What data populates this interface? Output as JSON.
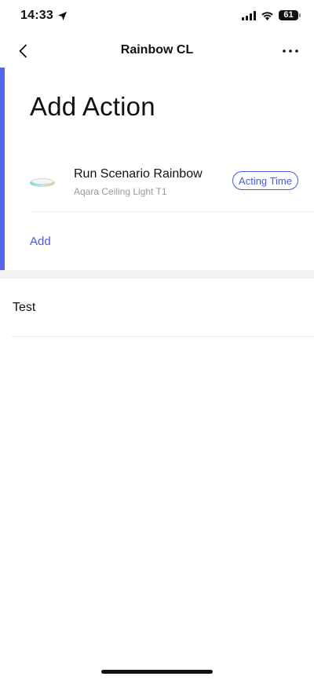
{
  "status_bar": {
    "time": "14:33",
    "battery": "61",
    "icons": [
      "location-arrow-icon",
      "cellular-signal-icon",
      "wifi-icon",
      "battery-icon"
    ]
  },
  "nav": {
    "title": "Rainbow CL",
    "back_icon": "chevron-left-icon",
    "more_icon": "more-dots-icon"
  },
  "action_card": {
    "heading": "Add Action",
    "accent_color": "#5566ee",
    "action": {
      "title": "Run Scenario Rainbow",
      "device": "Aqara Ceiling Light T1",
      "acting_time_label": "Acting Time",
      "device_icon": "ceiling-light-icon"
    },
    "add_label": "Add"
  },
  "test_row": {
    "label": "Test"
  },
  "colors": {
    "link": "#4a58d8",
    "subtitle": "#9a9a9a",
    "section_gap": "#f2f2f2"
  }
}
